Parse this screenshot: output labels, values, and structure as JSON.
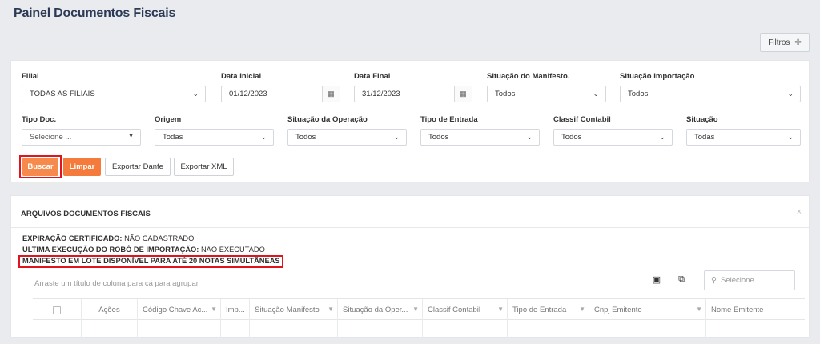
{
  "page": {
    "title": "Painel Documentos Fiscais"
  },
  "toolbar": {
    "filtros_label": "Filtros"
  },
  "filters": {
    "filial": {
      "label": "Filial",
      "value": "TODAS AS FILIAIS"
    },
    "data_inicial": {
      "label": "Data Inicial",
      "value": "01/12/2023"
    },
    "data_final": {
      "label": "Data Final",
      "value": "31/12/2023"
    },
    "situacao_manifesto": {
      "label": "Situação do Manifesto.",
      "value": "Todos"
    },
    "situacao_importacao": {
      "label": "Situação Importação",
      "value": "Todos"
    },
    "tipo_doc": {
      "label": "Tipo Doc.",
      "value": "Selecione ..."
    },
    "origem": {
      "label": "Origem",
      "value": "Todas"
    },
    "situacao_operacao": {
      "label": "Situação da Operação",
      "value": "Todos"
    },
    "tipo_entrada": {
      "label": "Tipo de Entrada",
      "value": "Todos"
    },
    "classif_contabil": {
      "label": "Classif Contabil",
      "value": "Todos"
    },
    "situacao": {
      "label": "Situação",
      "value": "Todas"
    }
  },
  "actions": {
    "buscar": "Buscar",
    "limpar": "Limpar",
    "exportar_danfe": "Exportar Danfe",
    "exportar_xml": "Exportar XML"
  },
  "panel": {
    "title": "ARQUIVOS DOCUMENTOS FISCAIS",
    "close": "×",
    "info": {
      "expiracao_label": "EXPIRAÇÃO CERTIFICADO:",
      "expiracao_value": "NÃO CADASTRADO",
      "ultima_label": "ÚLTIMA EXECUÇÃO DO ROBÔ DE IMPORTAÇÃO:",
      "ultima_value": "NÃO EXECUTADO",
      "manifesto": "MANIFESTO EM LOTE DISPONÍVEL PARA ATÉ 20 NOTAS SIMULTÂNEAS"
    },
    "group_hint": "Arraste um título de coluna para cá para agrupar",
    "search_placeholder": "Selecione"
  },
  "grid": {
    "columns": [
      "Ações",
      "Código Chave Ac...",
      "Imp...",
      "Situação Manifesto",
      "Situação da Oper...",
      "Classif Contabil",
      "Tipo de Entrada",
      "Cnpj Emitente",
      "Nome Emitente"
    ]
  },
  "icons": {
    "calendar": "calendar-icon",
    "chevron": "chevron-down-icon",
    "filter": "filter-icon",
    "excel": "excel-export-icon",
    "columns": "column-chooser-icon",
    "search": "search-icon",
    "pin": "pin-icon"
  },
  "colors": {
    "accent_orange": "#f58a4c",
    "highlight_red": "#e0141e",
    "title_navy": "#2b3a55"
  }
}
